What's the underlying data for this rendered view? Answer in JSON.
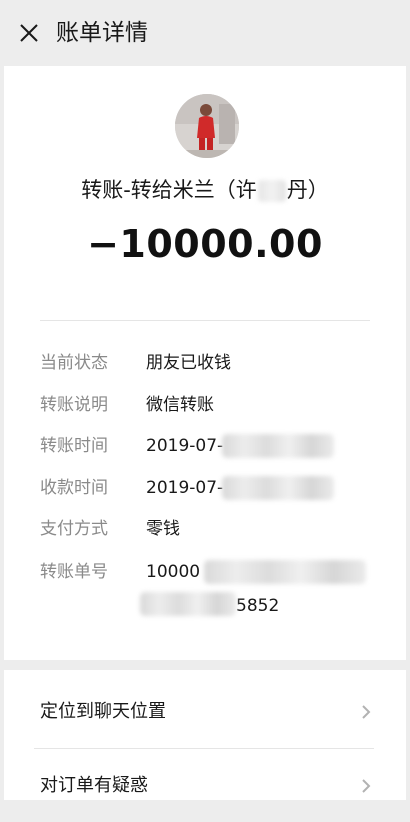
{
  "header": {
    "title": "账单详情",
    "close_icon": "close-icon"
  },
  "summary": {
    "payee_prefix": "转账-转给米兰（许",
    "payee_suffix": "丹）",
    "amount": "−10000.00"
  },
  "details": [
    {
      "label": "当前状态",
      "value": "朋友已收钱"
    },
    {
      "label": "转账说明",
      "value": "微信转账"
    },
    {
      "label": "转账时间",
      "value": "2019-07-"
    },
    {
      "label": "收款时间",
      "value": "2019-07-"
    },
    {
      "label": "支付方式",
      "value": "零钱"
    },
    {
      "label": "转账单号",
      "value": "10000",
      "value_line2": "5852"
    }
  ],
  "actions": [
    {
      "label": "定位到聊天位置",
      "icon": "chevron-right-icon"
    },
    {
      "label": "对订单有疑惑",
      "icon": "chevron-right-icon"
    }
  ],
  "colors": {
    "background": "#ededed",
    "card": "#ffffff",
    "label_gray": "#8a8a8a"
  }
}
